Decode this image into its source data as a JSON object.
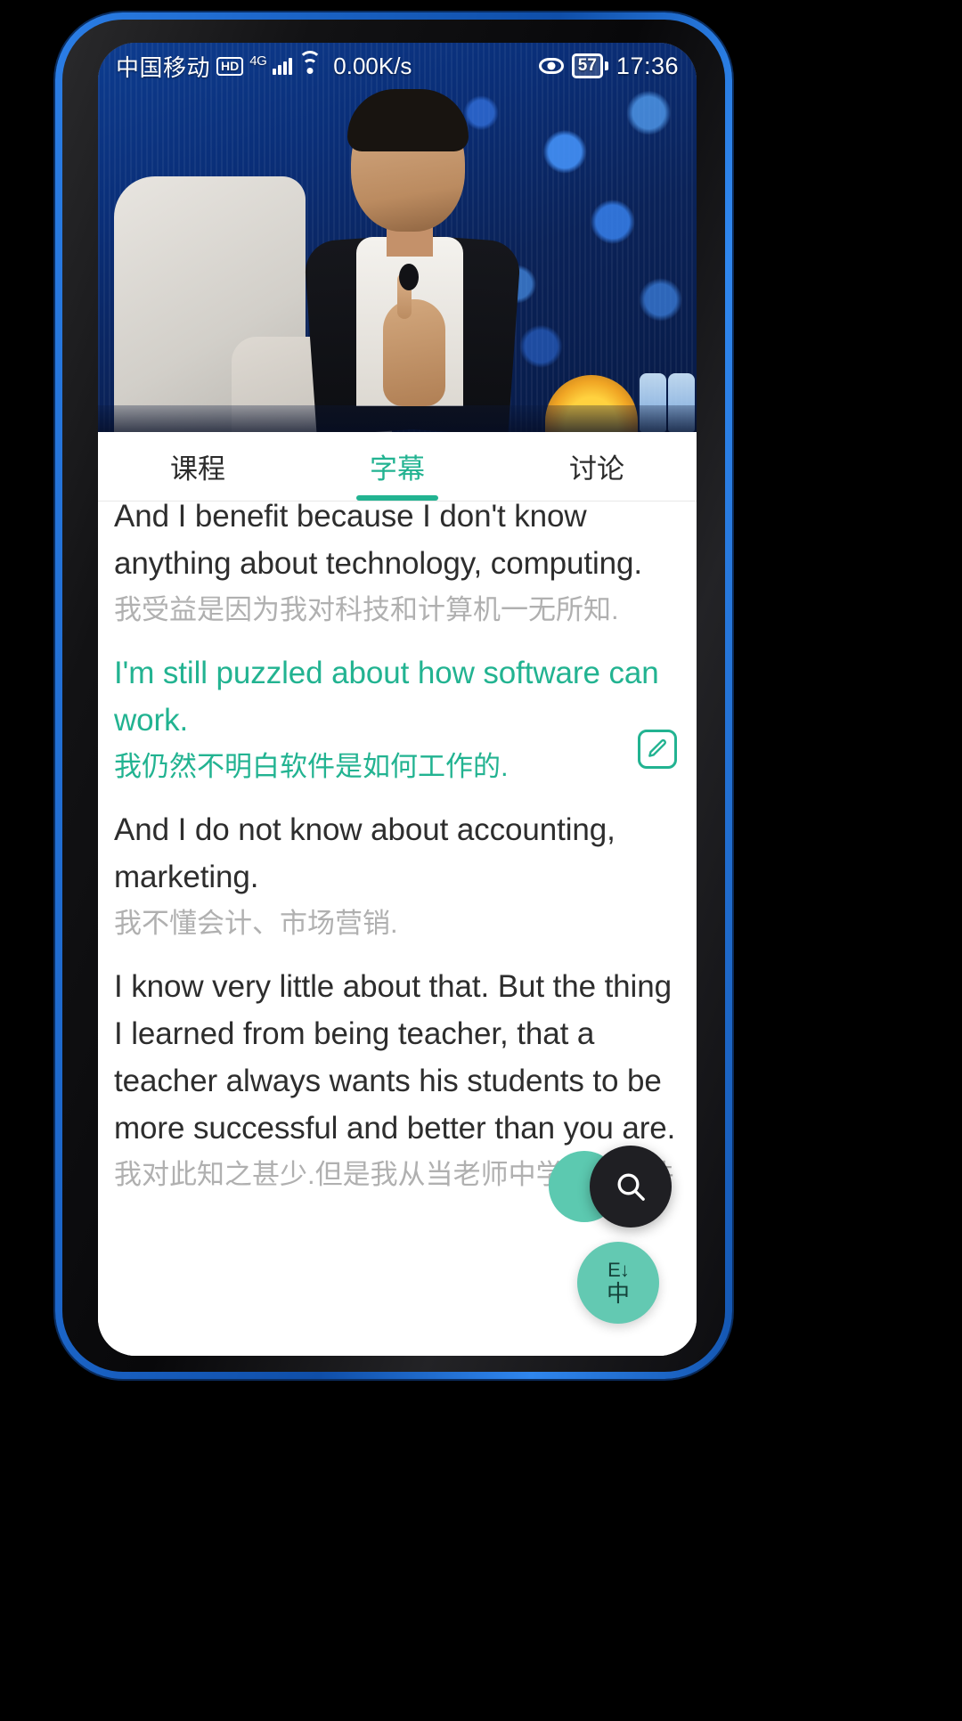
{
  "statusbar": {
    "carrier": "中国移动",
    "hd_badge": "HD",
    "network": "4G",
    "net_speed": "0.00K/s",
    "eye_icon": "eye-comfort-icon",
    "battery_level": "57",
    "clock": "17:36"
  },
  "video": {
    "description": "talk-show-video-frame",
    "playing": true
  },
  "tabs": [
    {
      "label": "课程",
      "active": false
    },
    {
      "label": "字幕",
      "active": true
    },
    {
      "label": "讨论",
      "active": false
    }
  ],
  "subtitles": [
    {
      "en": "And I benefit because I don't know anything about technology, computing.",
      "zh": "我受益是因为我对科技和计算机一无所知.",
      "active": false
    },
    {
      "en": "I'm still puzzled about how software can work.",
      "zh": "我仍然不明白软件是如何工作的.",
      "active": true
    },
    {
      "en": "And I do not know about accounting, marketing.",
      "zh": "我不懂会计、市场营销.",
      "active": false
    },
    {
      "en": "I know very little about that. But the thing I learned from being teacher, that a teacher always wants his students to be more successful and better than you are.",
      "zh": "我对此知之甚少.但是我从当老师中学到的一件",
      "active": false
    }
  ],
  "edit_button": {
    "icon": "pencil-edit-icon"
  },
  "fab": {
    "search": {
      "icon": "search-magnifier-icon"
    },
    "translate": {
      "glyph": "E↓",
      "label": "中"
    }
  },
  "colors": {
    "accent": "#22b391",
    "fab_teal": "#63c9b2",
    "fab_dark": "#1f1f23",
    "text_primary": "#2d2d2d",
    "text_secondary": "#b0b0b0",
    "frame_blue": "#1d6fd6"
  }
}
